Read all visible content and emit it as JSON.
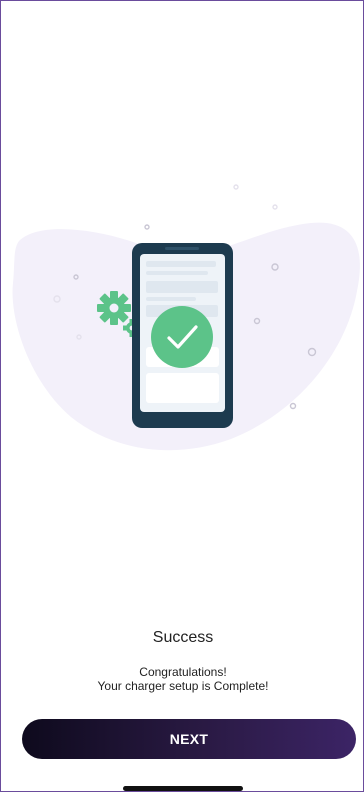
{
  "success": {
    "title": "Success",
    "message_line1": "Congratulations!",
    "message_line2": "Your charger setup is Complete!"
  },
  "actions": {
    "next_label": "NEXT"
  },
  "illustration": {
    "icons": [
      "phone-icon",
      "checkmark-icon",
      "gear-icon"
    ]
  },
  "colors": {
    "accent_green": "#5cc389",
    "blob": "#f2effa",
    "phone_frame": "#1d3b4f",
    "button_start": "#0e0a1d",
    "button_end": "#3c2466"
  }
}
